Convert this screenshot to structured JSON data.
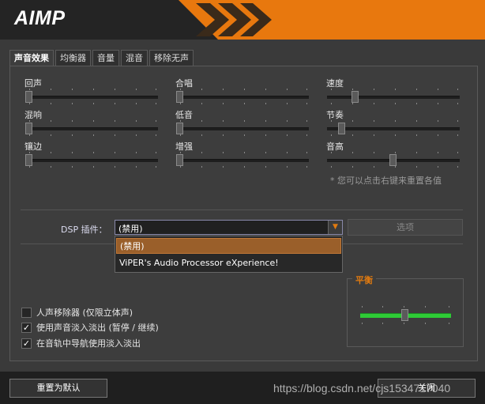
{
  "app": {
    "logo": "AIMP"
  },
  "tabs": [
    "声音效果",
    "均衡器",
    "音量",
    "混音",
    "移除无声"
  ],
  "sliders": {
    "echo": "回声",
    "chorus": "合唱",
    "speed": "速度",
    "reverb": "混响",
    "bass": "低音",
    "tempo": "节奏",
    "flanger": "镶边",
    "enhance": "增强",
    "pitch": "音高"
  },
  "note": "* 您可以点击右键来重置各值",
  "dsp": {
    "label": "DSP 插件：",
    "value": "(禁用)",
    "options_label": "选项",
    "items": [
      "(禁用)",
      "ViPER's Audio Processor eXperience!"
    ]
  },
  "checkboxes": [
    {
      "label": "人声移除器 (仅限立体声)",
      "checked": false
    },
    {
      "label": "使用声音淡入淡出 (暂停 / 继续)",
      "checked": true
    },
    {
      "label": "在音轨中导航使用淡入淡出",
      "checked": true
    }
  ],
  "balance": {
    "title": "平衡"
  },
  "footer": {
    "reset_label": "重置为默认",
    "close_label": "关闭"
  },
  "watermark": "https://blog.csdn.net/cjs1534717040"
}
